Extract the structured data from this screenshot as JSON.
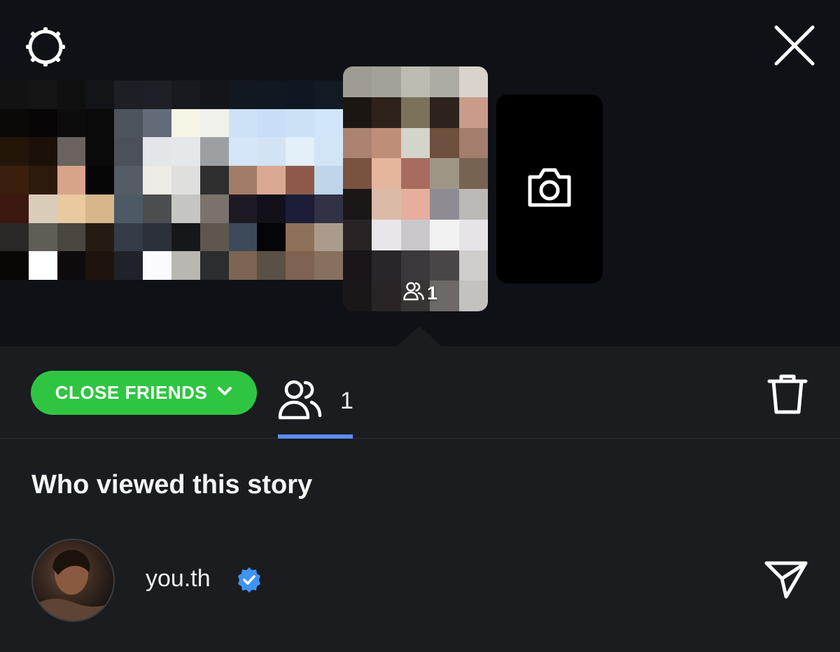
{
  "header": {
    "settings_icon": "gear-icon",
    "close_icon": "close-icon"
  },
  "story": {
    "viewer_count": "1",
    "add_story_icon": "camera-icon"
  },
  "toolbar": {
    "audience_label": "CLOSE FRIENDS",
    "audience_color": "#2fc542",
    "viewers_count": "1",
    "tab_accent": "#5b8cf5",
    "delete_icon": "trash-icon"
  },
  "viewers": {
    "title": "Who viewed this story",
    "items": [
      {
        "username": "you.th",
        "verified": true,
        "action_icon": "send-icon"
      }
    ]
  }
}
